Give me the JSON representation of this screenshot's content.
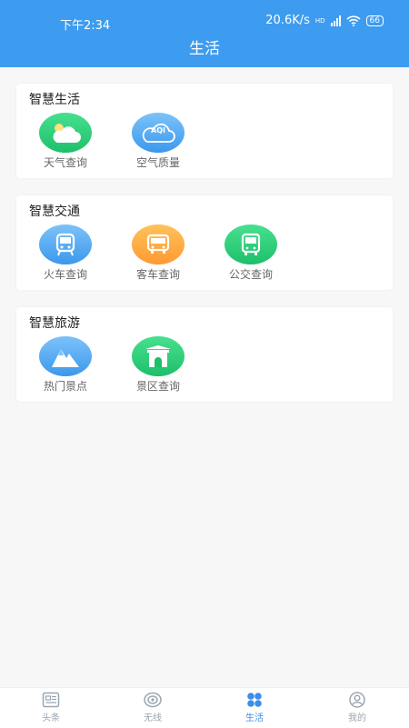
{
  "status": {
    "time": "下午2:34",
    "speed": "20.6K/s",
    "hd": "HD",
    "battery": "66"
  },
  "header": {
    "title": "生活"
  },
  "sections": [
    {
      "title": "智慧生活",
      "items": [
        {
          "label": "天气查询",
          "icon": "weather-cloud-sun-icon"
        },
        {
          "label": "空气质量",
          "icon": "aqi-cloud-icon",
          "icon_text": "AQI"
        }
      ]
    },
    {
      "title": "智慧交通",
      "items": [
        {
          "label": "火车查询",
          "icon": "train-icon"
        },
        {
          "label": "客车查询",
          "icon": "coach-bus-icon"
        },
        {
          "label": "公交查询",
          "icon": "city-bus-icon"
        }
      ]
    },
    {
      "title": "智慧旅游",
      "items": [
        {
          "label": "热门景点",
          "icon": "mountain-icon"
        },
        {
          "label": "景区查询",
          "icon": "gate-icon"
        }
      ]
    }
  ],
  "tabs": [
    {
      "label": "头条",
      "icon": "news-icon",
      "active": false
    },
    {
      "label": "无线",
      "icon": "wireless-icon",
      "active": false
    },
    {
      "label": "生活",
      "icon": "life-grid-icon",
      "active": true
    },
    {
      "label": "我的",
      "icon": "profile-icon",
      "active": false
    }
  ],
  "colors": {
    "primary": "#3d9cf0",
    "green": "#1fbf6a",
    "blue": "#3c98ec",
    "orange": "#ff9a34",
    "tab_active": "#3d8fe6"
  }
}
